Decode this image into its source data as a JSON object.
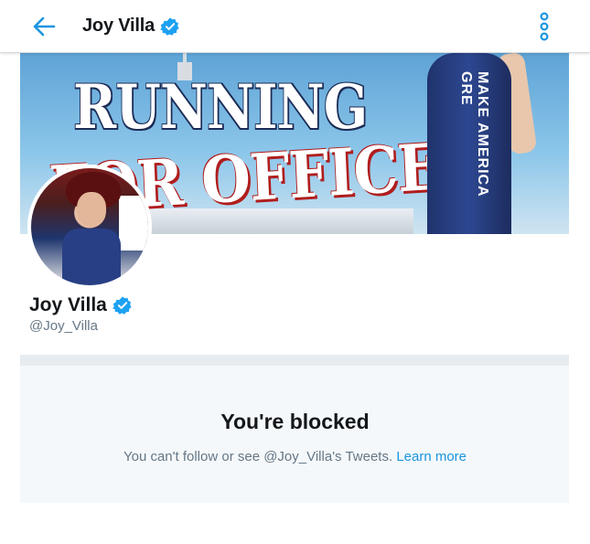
{
  "header": {
    "title": "Joy Villa",
    "back_icon": "arrow-left-icon",
    "more_icon": "vertical-dots-icon",
    "verified_icon": "verified-badge-icon"
  },
  "banner": {
    "line1": "RUNNING",
    "line2": "FOR OFFICE?",
    "dress_text": "MAKE AMERICA GRE"
  },
  "profile": {
    "name": "Joy Villa",
    "handle": "@Joy_Villa",
    "verified_icon": "verified-badge-icon"
  },
  "blocked": {
    "title": "You're blocked",
    "message": "You can't follow or see @Joy_Villa's Tweets.",
    "link": "Learn more"
  },
  "colors": {
    "accent": "#1b95e0",
    "verified": "#1da1f2",
    "text_primary": "#14171a",
    "text_secondary": "#657786",
    "card_bg": "#f5f8fa"
  }
}
